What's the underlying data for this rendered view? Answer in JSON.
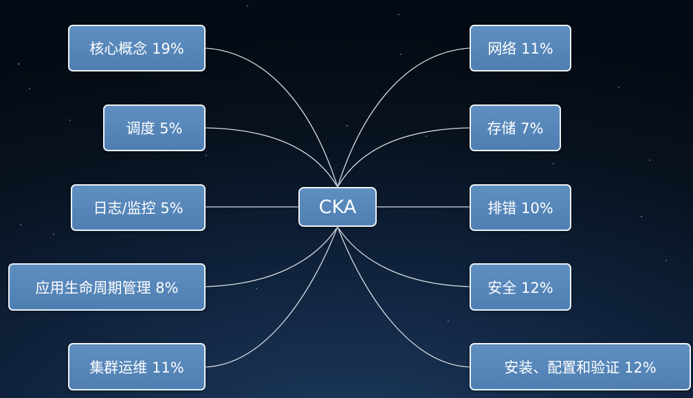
{
  "center": {
    "label": "CKA"
  },
  "left_topics": [
    {
      "label": "核心概念 19%"
    },
    {
      "label": "调度 5%"
    },
    {
      "label": "日志/监控 5%"
    },
    {
      "label": "应用生命周期管理 8%"
    },
    {
      "label": "集群运维 11%"
    }
  ],
  "right_topics": [
    {
      "label": "网络 11%"
    },
    {
      "label": "存储 7%"
    },
    {
      "label": "排错 10%"
    },
    {
      "label": "安全 12%"
    },
    {
      "label": "安装、配置和验证 12%"
    }
  ],
  "colors": {
    "node_fill": "#5585b8",
    "node_border": "#eef3f8",
    "connector": "#d8dde4",
    "background": "#0b1a2e"
  }
}
